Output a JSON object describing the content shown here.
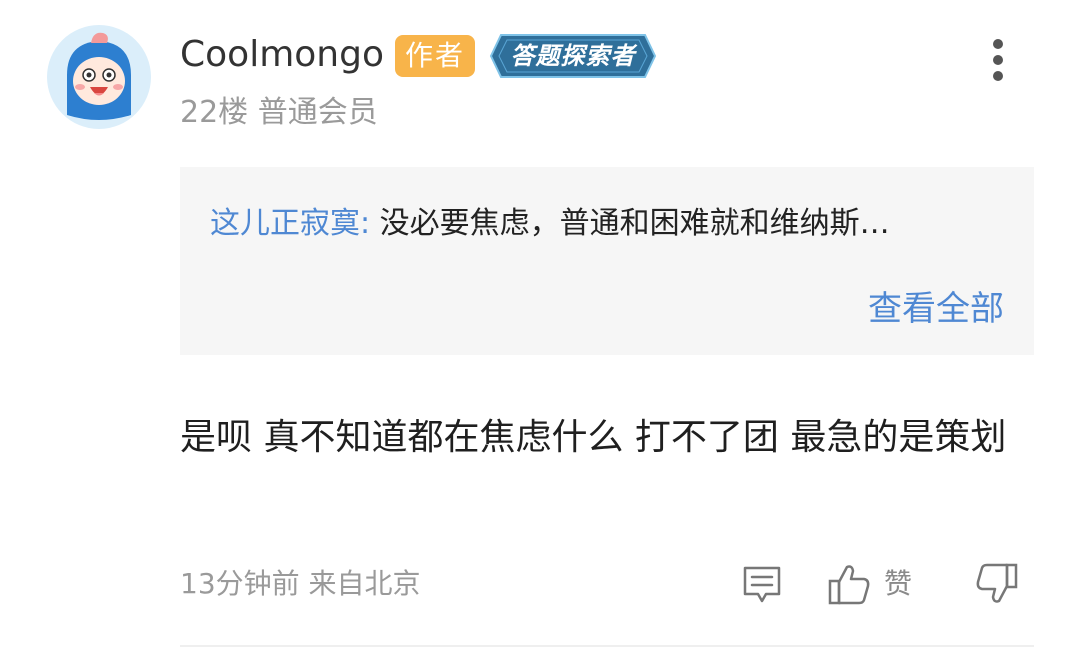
{
  "comment": {
    "username": "Coolmongo",
    "author_badge": "作者",
    "honor_badge": "答题探索者",
    "floor_and_level": "22楼 普通会员",
    "quote": {
      "user": "这儿正寂寞:",
      "text": "没必要焦虑，普通和困难就和维纳斯…",
      "view_all": "查看全部"
    },
    "body_text": "是呗 真不知道都在焦虑什么 打不了团 最急的是策划",
    "time_location": "13分钟前 来自北京",
    "like_label": "赞"
  },
  "icons": {
    "more": "more-vertical-icon",
    "reply": "comment-reply-icon",
    "like": "thumbs-up-icon",
    "dislike": "thumbs-down-icon"
  },
  "colors": {
    "link_blue": "#4f88d3",
    "author_badge": "#f8b44a",
    "honor_badge": "#2f6f9a",
    "muted_text": "#9a9a9a",
    "quote_bg": "#f6f6f6"
  }
}
